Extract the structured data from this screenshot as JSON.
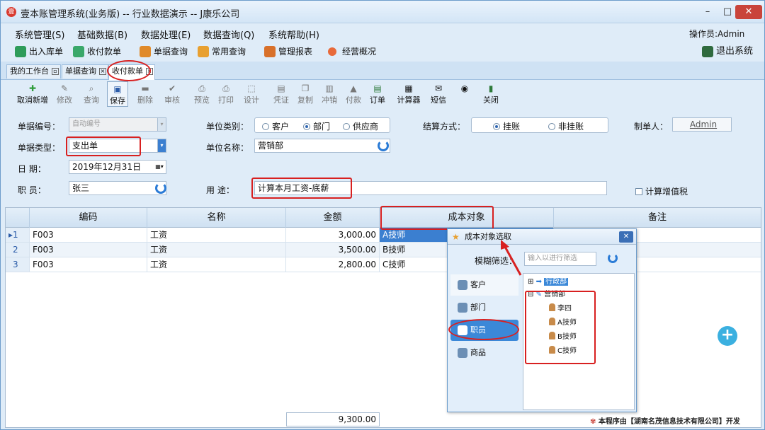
{
  "window": {
    "title": "壹本账管理系统(业务版) -- 行业数据演示 -- J康乐公司"
  },
  "menu": [
    "系统管理(S)",
    "基础数据(B)",
    "数据处理(E)",
    "数据查询(Q)",
    "系统帮助(H)"
  ],
  "operator": "操作员:Admin",
  "quick": [
    "出入库单",
    "收付款单",
    "单据查询",
    "常用查询",
    "管理报表",
    "经营概况",
    "退出系统"
  ],
  "tabs": [
    "我的工作台",
    "单据查询",
    "收付款单"
  ],
  "toolbar": [
    "取消新增",
    "修改",
    "查询",
    "保存",
    "删除",
    "审核",
    "预览",
    "打印",
    "设计",
    "凭证",
    "复制",
    "冲销",
    "付款",
    "订单",
    "计算器",
    "短信",
    "关闭"
  ],
  "form": {
    "doc_no_label": "单据编号：",
    "doc_no_placeholder": "自动编号",
    "doc_type_label": "单据类型：",
    "doc_type": "支出单",
    "date_label": "日    期：",
    "date": "2019年12月31日",
    "staff_label": "职    员：",
    "staff": "张三",
    "unit_type_label": "单位类别：",
    "unit_types": [
      "客户",
      "部门",
      "供应商"
    ],
    "unit_type_selected": 1,
    "unit_name_label": "单位名称：",
    "unit_name": "营销部",
    "usage_label": "用    途：",
    "usage": "计算本月工资-底薪",
    "settle_label": "结算方式：",
    "settle_types": [
      "挂账",
      "非挂账"
    ],
    "settle_selected": 0,
    "maker_label": "制单人：",
    "maker": "Admin",
    "vat_label": "计算增值税"
  },
  "grid": {
    "headers": [
      "编码",
      "名称",
      "金额",
      "成本对象",
      "备注"
    ],
    "rows": [
      {
        "no": "1",
        "code": "F003",
        "name": "工资",
        "amount": "3,000.00",
        "cost": "A技师"
      },
      {
        "no": "2",
        "code": "F003",
        "name": "工资",
        "amount": "3,500.00",
        "cost": "B技师"
      },
      {
        "no": "3",
        "code": "F003",
        "name": "工资",
        "amount": "2,800.00",
        "cost": "C技师"
      }
    ],
    "total": "9,300.00"
  },
  "popup": {
    "title": "成本对象选取",
    "filter_label": "模糊筛选：",
    "filter_placeholder": "输入以进行筛选",
    "categories": [
      "客户",
      "部门",
      "职员",
      "商品"
    ],
    "tree": [
      "行政部",
      "营销部",
      "李四",
      "A技师",
      "B技师",
      "C技师"
    ]
  },
  "watermark": "本程序由【湖南名茂信息技术有限公司】开发"
}
